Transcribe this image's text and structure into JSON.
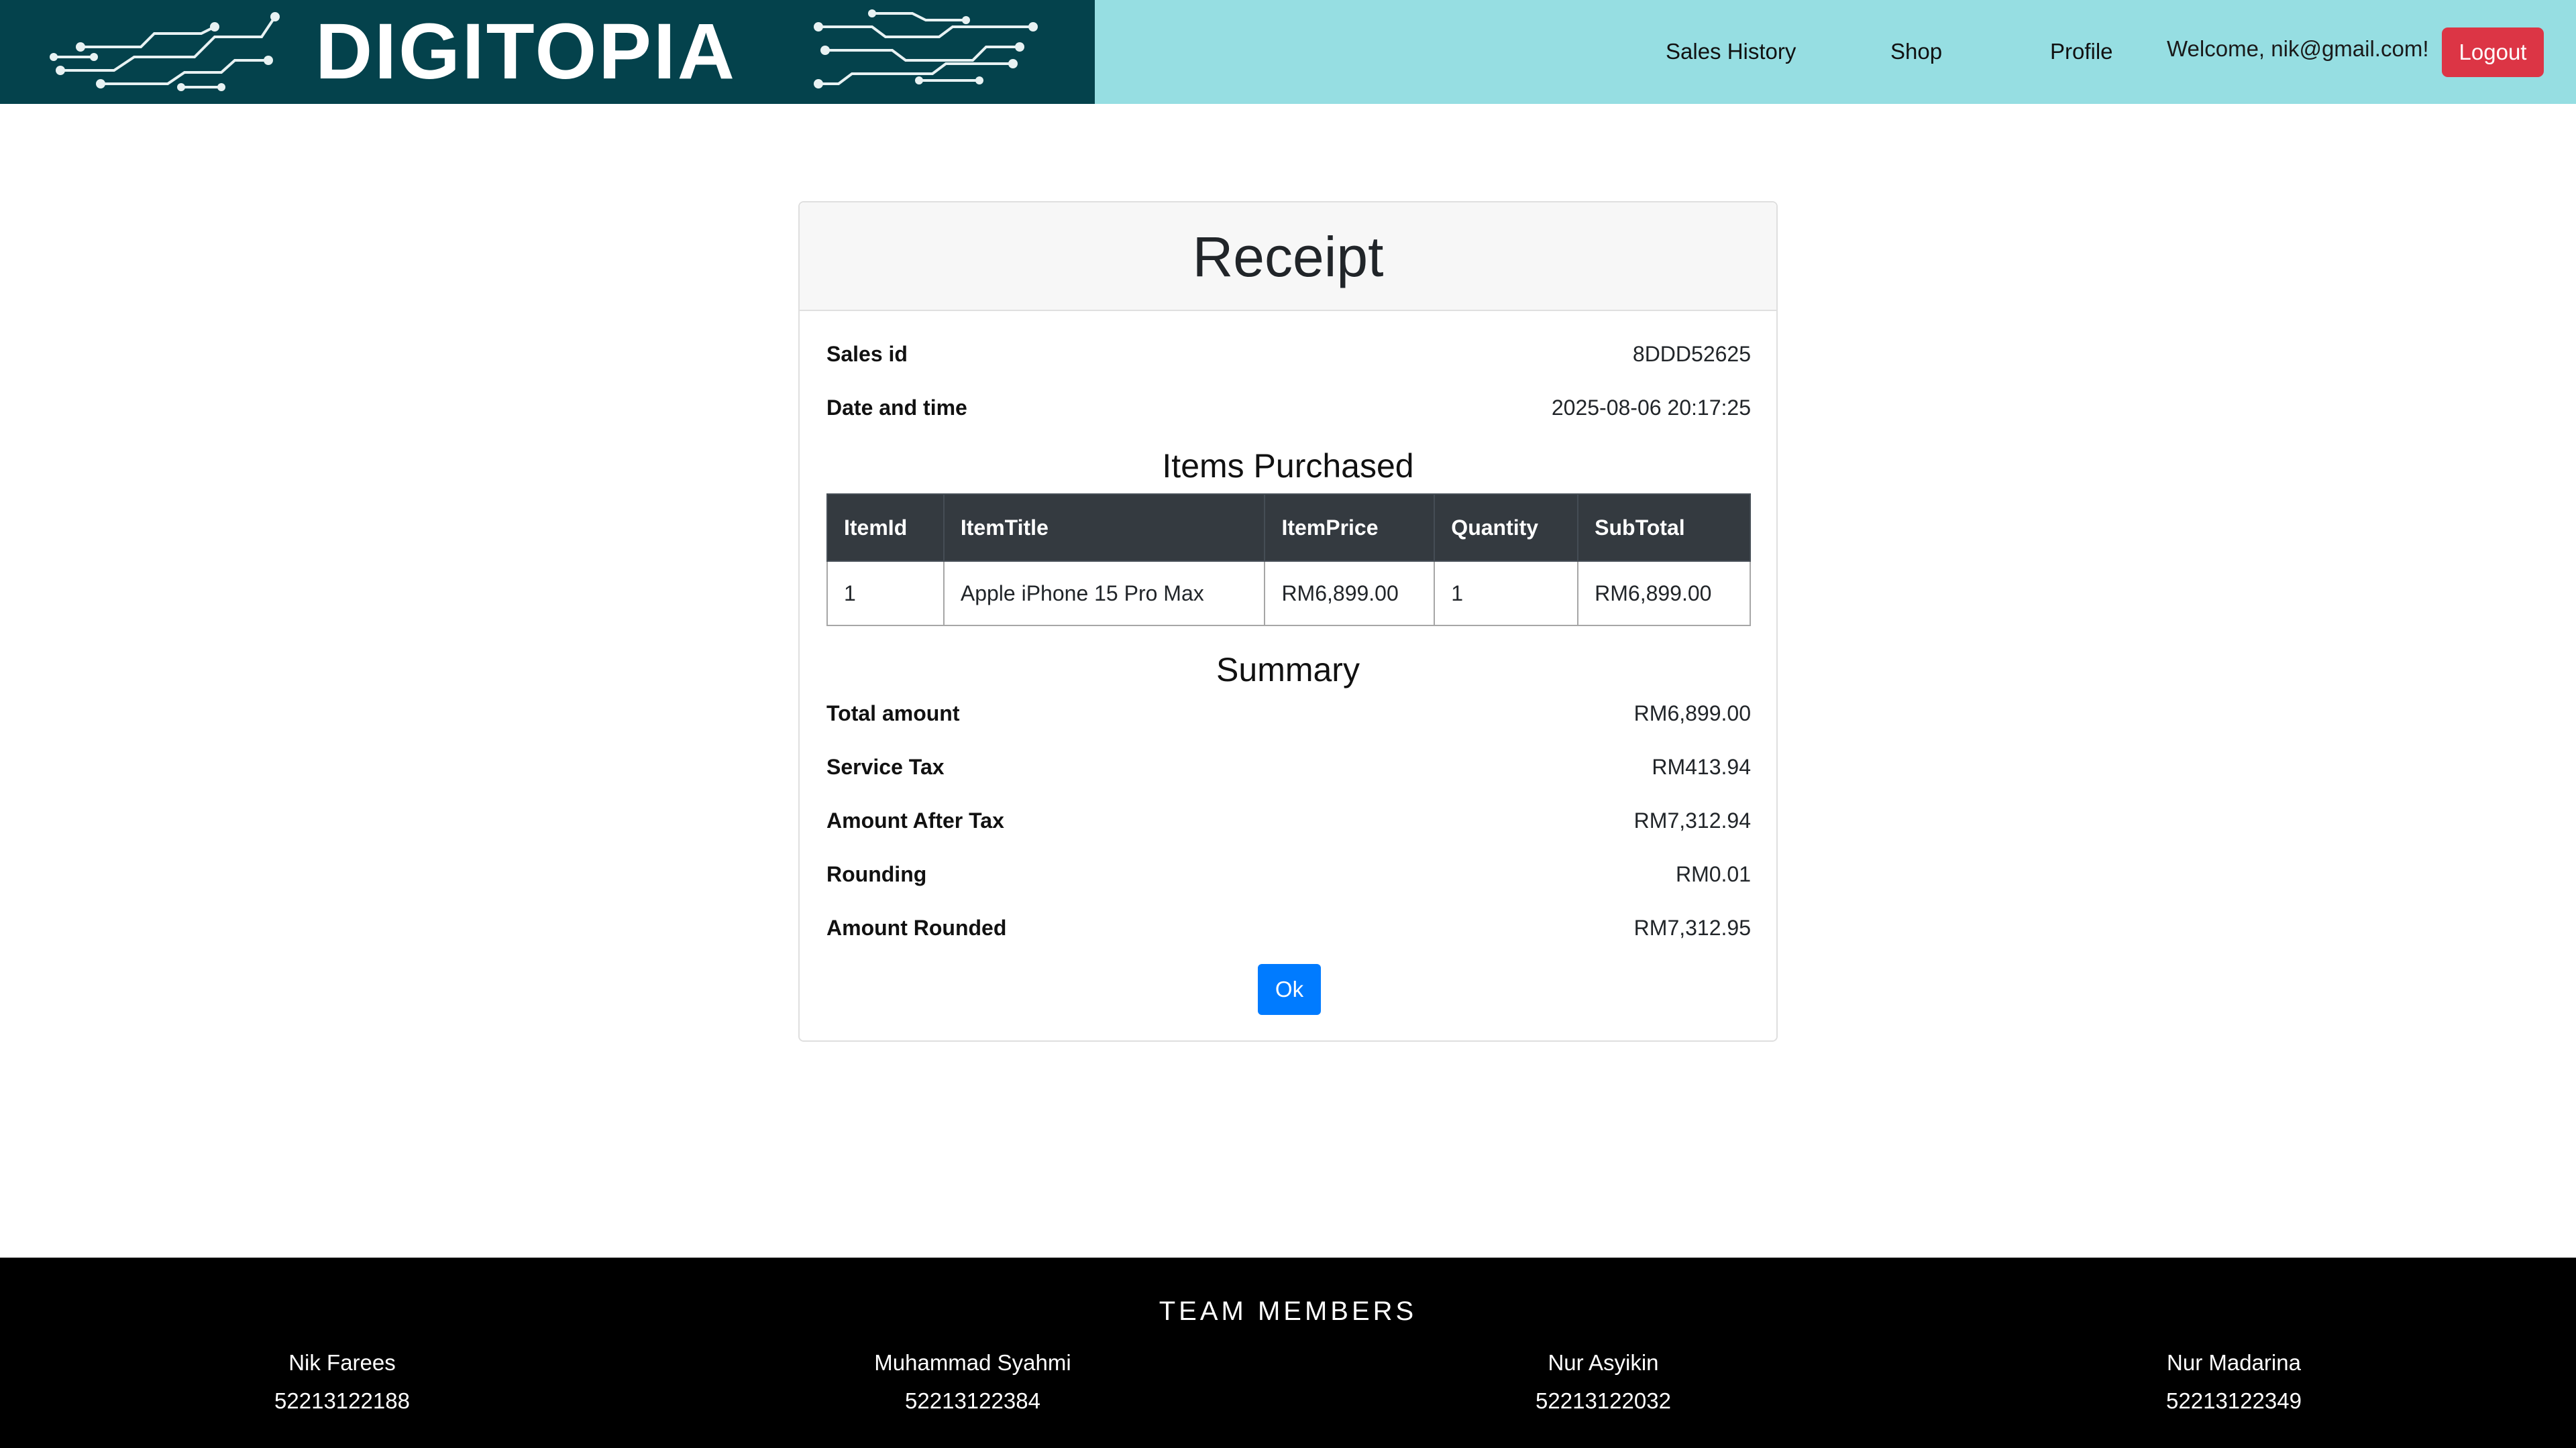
{
  "header": {
    "logo_text": "DIGITOPIA",
    "nav": [
      "Sales History",
      "Shop",
      "Profile"
    ],
    "welcome": "Welcome, nik@gmail.com!",
    "logout_label": "Logout"
  },
  "receipt": {
    "title": "Receipt",
    "sales_id_label": "Sales id",
    "sales_id": "8DDD52625",
    "datetime_label": "Date and time",
    "datetime": "2025-08-06 20:17:25",
    "items_title": "Items Purchased",
    "columns": [
      "ItemId",
      "ItemTitle",
      "ItemPrice",
      "Quantity",
      "SubTotal"
    ],
    "rows": [
      [
        "1",
        "Apple iPhone 15 Pro Max",
        "RM6,899.00",
        "1",
        "RM6,899.00"
      ]
    ],
    "summary_title": "Summary",
    "summary": [
      {
        "label": "Total amount",
        "value": "RM6,899.00"
      },
      {
        "label": "Service Tax",
        "value": "RM413.94"
      },
      {
        "label": "Amount After Tax",
        "value": "RM7,312.94"
      },
      {
        "label": "Rounding",
        "value": "RM0.01"
      },
      {
        "label": "Amount Rounded",
        "value": "RM7,312.95"
      }
    ],
    "ok_label": "Ok"
  },
  "footer": {
    "title": "TEAM MEMBERS",
    "members": [
      {
        "name": "Nik Farees",
        "id": "52213122188"
      },
      {
        "name": "Muhammad Syahmi",
        "id": "52213122384"
      },
      {
        "name": "Nur Asyikin",
        "id": "52213122032"
      },
      {
        "name": "Nur Madarina",
        "id": "52213122349"
      }
    ]
  },
  "colors": {
    "header_bg": "#96dee2",
    "logo_bg": "#04424c",
    "logout": "#dc3545",
    "ok": "#007bff",
    "table_head": "#343a40",
    "footer_bg": "#000000"
  }
}
